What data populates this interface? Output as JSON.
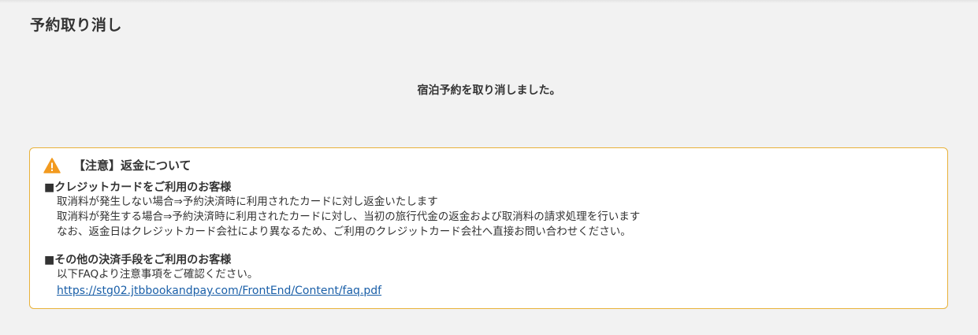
{
  "page": {
    "title": "予約取り消し",
    "result_message": "宿泊予約を取り消しました。"
  },
  "notice": {
    "icon": "warning-icon",
    "accent_color": "#e8b23a",
    "title": "【注意】返金について",
    "credit_section": {
      "heading": "■クレジットカードをご利用のお客様",
      "lines": [
        "取消料が発生しない場合⇒予約決済時に利用されたカードに対し返金いたします",
        "取消料が発生する場合⇒予約決済時に利用されたカードに対し、当初の旅行代金の返金および取消料の請求処理を行います",
        "なお、返金日はクレジットカード会社により異なるため、ご利用のクレジットカード会社へ直接お問い合わせください。"
      ]
    },
    "other_section": {
      "heading": "■その他の決済手段をご利用のお客様",
      "lines": [
        "以下FAQより注意事項をご確認ください。"
      ],
      "link": " https://stg02.jtbbookandpay.com/FrontEnd/Content/faq.pdf"
    }
  }
}
